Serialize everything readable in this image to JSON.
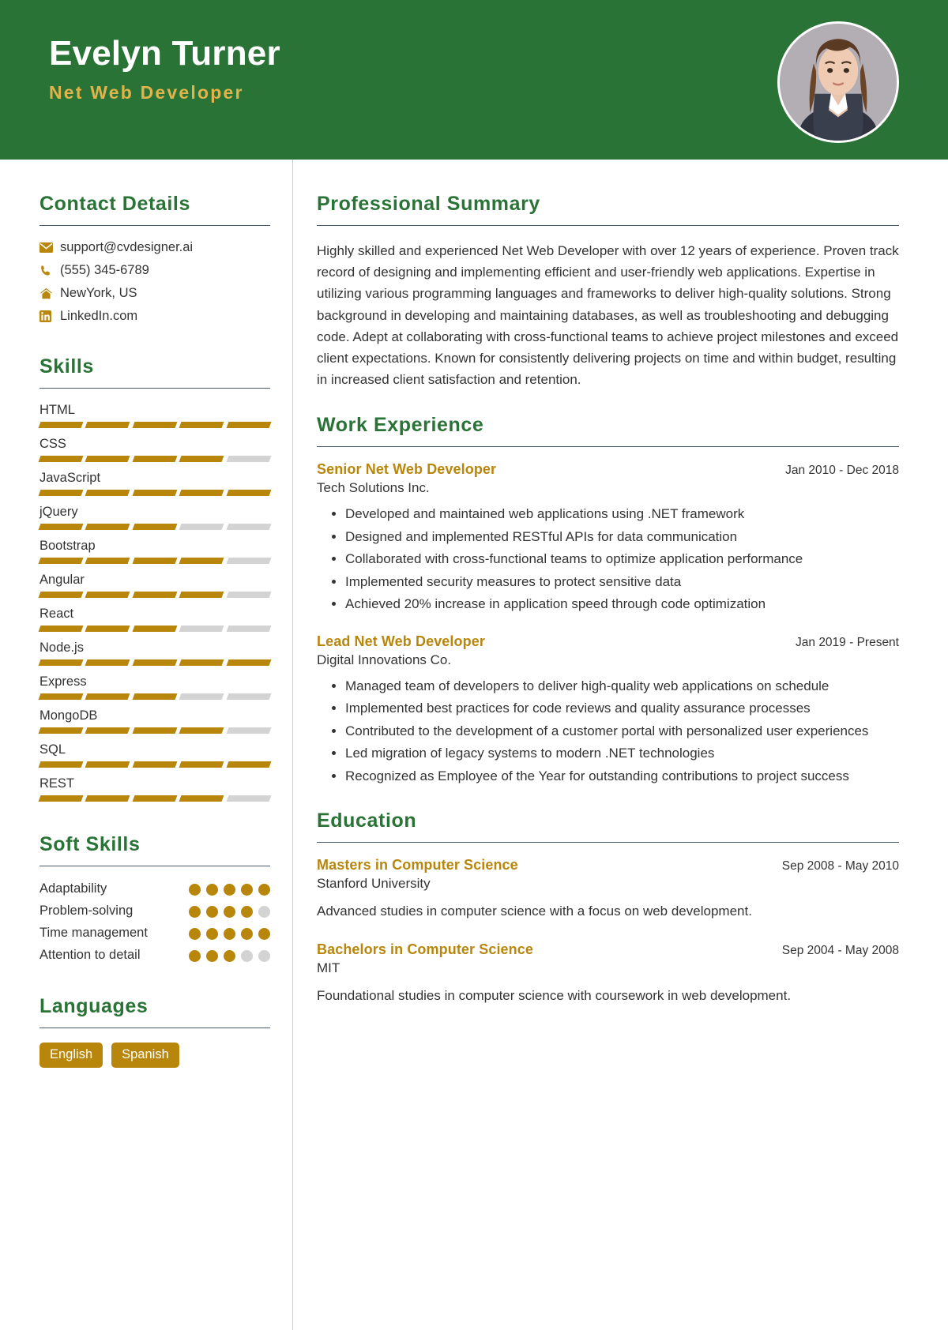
{
  "colors": {
    "header_green": "#2a7337",
    "accent_gold": "#b8860b",
    "role_gold": "#e0b44a",
    "rule": "#49576b",
    "muted_bar": "#d3d3d3"
  },
  "header": {
    "name": "Evelyn Turner",
    "role": "Net Web Developer"
  },
  "contact": {
    "title": "Contact Details",
    "items": [
      {
        "icon": "email-icon",
        "value": "support@cvdesigner.ai"
      },
      {
        "icon": "phone-icon",
        "value": "(555) 345-6789"
      },
      {
        "icon": "home-icon",
        "value": "NewYork, US"
      },
      {
        "icon": "linkedin-icon",
        "value": "LinkedIn.com"
      }
    ]
  },
  "skills": {
    "title": "Skills",
    "max": 5,
    "items": [
      {
        "name": "HTML",
        "level": 5
      },
      {
        "name": "CSS",
        "level": 4
      },
      {
        "name": "JavaScript",
        "level": 5
      },
      {
        "name": "jQuery",
        "level": 3
      },
      {
        "name": "Bootstrap",
        "level": 4
      },
      {
        "name": "Angular",
        "level": 4
      },
      {
        "name": "React",
        "level": 3
      },
      {
        "name": "Node.js",
        "level": 5
      },
      {
        "name": "Express",
        "level": 3
      },
      {
        "name": "MongoDB",
        "level": 4
      },
      {
        "name": "SQL",
        "level": 5
      },
      {
        "name": "REST",
        "level": 4
      }
    ]
  },
  "soft_skills": {
    "title": "Soft Skills",
    "max": 5,
    "items": [
      {
        "name": "Adaptability",
        "level": 5
      },
      {
        "name": "Problem-solving",
        "level": 4
      },
      {
        "name": "Time management",
        "level": 5
      },
      {
        "name": "Attention to detail",
        "level": 3
      }
    ]
  },
  "languages": {
    "title": "Languages",
    "items": [
      "English",
      "Spanish"
    ]
  },
  "summary": {
    "title": "Professional Summary",
    "text": "Highly skilled and experienced Net Web Developer with over 12 years of experience. Proven track record of designing and implementing efficient and user-friendly web applications. Expertise in utilizing various programming languages and frameworks to deliver high-quality solutions. Strong background in developing and maintaining databases, as well as troubleshooting and debugging code. Adept at collaborating with cross-functional teams to achieve project milestones and exceed client expectations. Known for consistently delivering projects on time and within budget, resulting in increased client satisfaction and retention."
  },
  "work": {
    "title": "Work Experience",
    "entries": [
      {
        "role": "Senior Net Web Developer",
        "company": "Tech Solutions Inc.",
        "dates": "Jan 2010 - Dec 2018",
        "bullets": [
          "Developed and maintained web applications using .NET framework",
          "Designed and implemented RESTful APIs for data communication",
          "Collaborated with cross-functional teams to optimize application performance",
          "Implemented security measures to protect sensitive data",
          "Achieved 20% increase in application speed through code optimization"
        ]
      },
      {
        "role": "Lead Net Web Developer",
        "company": "Digital Innovations Co.",
        "dates": "Jan 2019 - Present",
        "bullets": [
          "Managed team of developers to deliver high-quality web applications on schedule",
          "Implemented best practices for code reviews and quality assurance processes",
          "Contributed to the development of a customer portal with personalized user experiences",
          "Led migration of legacy systems to modern .NET technologies",
          "Recognized as Employee of the Year for outstanding contributions to project success"
        ]
      }
    ]
  },
  "education": {
    "title": "Education",
    "entries": [
      {
        "degree": "Masters in Computer Science",
        "school": "Stanford University",
        "dates": "Sep 2008 - May 2010",
        "description": "Advanced studies in computer science with a focus on web development."
      },
      {
        "degree": "Bachelors in Computer Science",
        "school": "MIT",
        "dates": "Sep 2004 - May 2008",
        "description": "Foundational studies in computer science with coursework in web development."
      }
    ]
  }
}
